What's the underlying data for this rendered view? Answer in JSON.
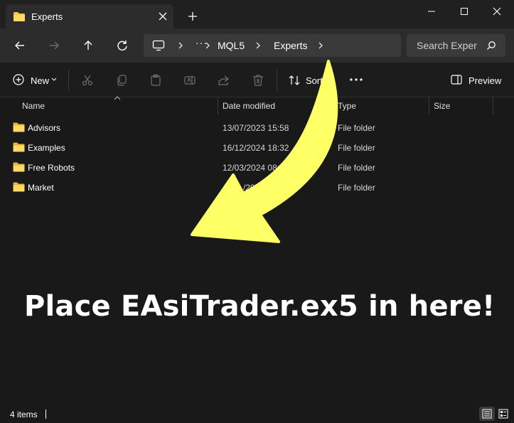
{
  "tab": {
    "title": "Experts",
    "close_icon": "close-icon",
    "new_tab_icon": "plus-icon"
  },
  "window_controls": [
    "minimize-icon",
    "maximize-icon",
    "close-icon"
  ],
  "addressbar": {
    "breadcrumbs": [
      "MQL5",
      "Experts"
    ],
    "overflow": "···",
    "search_placeholder": "Search Exper"
  },
  "toolbar": {
    "new_label": "New",
    "sort_label": "Sort",
    "preview_label": "Preview"
  },
  "columns": [
    "Name",
    "Date modified",
    "Type",
    "Size"
  ],
  "files": [
    {
      "name": "Advisors",
      "date": "13/07/2023 15:58",
      "type": "File folder"
    },
    {
      "name": "Examples",
      "date": "16/12/2024 18:32",
      "type": "File folder"
    },
    {
      "name": "Free Robots",
      "date": "12/03/2024 08:49",
      "type": "File folder"
    },
    {
      "name": "Market",
      "date": "/2025",
      "type": "File folder"
    }
  ],
  "status": {
    "item_count": "4 items"
  },
  "annotation": {
    "text": "Place EAsiTrader.ex5 in here!",
    "arrow_color": "#ffff66"
  },
  "colors": {
    "folder": "#f8c74d",
    "accent": "#4c9be8",
    "background": "#191919"
  }
}
